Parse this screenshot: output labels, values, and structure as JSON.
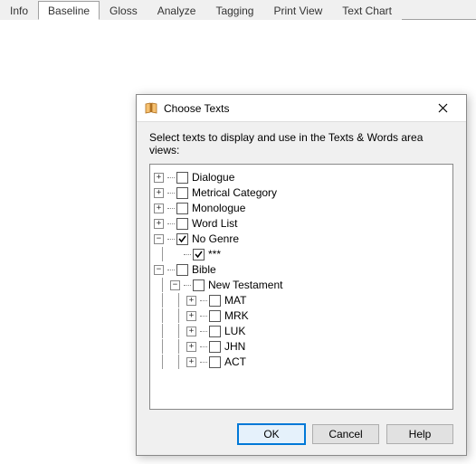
{
  "tabs": {
    "items": [
      "Info",
      "Baseline",
      "Gloss",
      "Analyze",
      "Tagging",
      "Print View",
      "Text Chart"
    ],
    "active_index": 1
  },
  "dialog": {
    "title": "Choose Texts",
    "instruction": "Select texts to display and use in the Texts & Words area views:",
    "buttons": {
      "ok": "OK",
      "cancel": "Cancel",
      "help": "Help"
    }
  },
  "tree": {
    "nodes": [
      {
        "id": "dialogue",
        "label": "Dialogue",
        "depth": 0,
        "expander": "+",
        "checked": false
      },
      {
        "id": "metrical",
        "label": "Metrical Category",
        "depth": 0,
        "expander": "+",
        "checked": false
      },
      {
        "id": "monologue",
        "label": "Monologue",
        "depth": 0,
        "expander": "+",
        "checked": false
      },
      {
        "id": "wordlist",
        "label": "Word List",
        "depth": 0,
        "expander": "+",
        "checked": false
      },
      {
        "id": "nogenre",
        "label": "No Genre",
        "depth": 0,
        "expander": "-",
        "checked": true
      },
      {
        "id": "stars",
        "label": "***",
        "depth": 1,
        "expander": " ",
        "checked": true
      },
      {
        "id": "bible",
        "label": "Bible",
        "depth": 0,
        "expander": "-",
        "checked": false
      },
      {
        "id": "nt",
        "label": "New Testament",
        "depth": 1,
        "expander": "-",
        "checked": false
      },
      {
        "id": "mat",
        "label": "MAT",
        "depth": 2,
        "expander": "+",
        "checked": false
      },
      {
        "id": "mrk",
        "label": "MRK",
        "depth": 2,
        "expander": "+",
        "checked": false
      },
      {
        "id": "luk",
        "label": "LUK",
        "depth": 2,
        "expander": "+",
        "checked": false
      },
      {
        "id": "jhn",
        "label": "JHN",
        "depth": 2,
        "expander": "+",
        "checked": false
      },
      {
        "id": "act",
        "label": "ACT",
        "depth": 2,
        "expander": "+",
        "checked": false
      }
    ]
  }
}
